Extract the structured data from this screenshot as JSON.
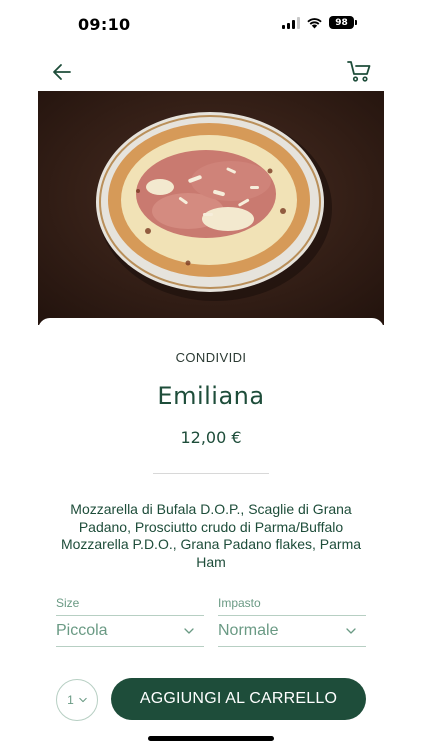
{
  "status_bar": {
    "time": "09:10",
    "battery": "98"
  },
  "nav": {
    "back_icon": "arrow-left-icon",
    "cart_icon": "cart-icon"
  },
  "hero": {
    "alt": "Emiliana pizza"
  },
  "product": {
    "share_label": "CONDIVIDI",
    "name": "Emiliana",
    "price": "12,00 €",
    "description": "Mozzarella di Bufala D.O.P., Scaglie di Grana Padano, Prosciutto crudo di Parma/Buffalo Mozzarella P.D.O., Grana Padano flakes, Parma Ham"
  },
  "options": {
    "size": {
      "label": "Size",
      "value": "Piccola"
    },
    "dough": {
      "label": "Impasto",
      "value": "Normale"
    }
  },
  "quantity": {
    "value": "1"
  },
  "cta": {
    "label": "AGGIUNGI AL CARRELLO"
  },
  "colors": {
    "brand": "#1e4d3a",
    "muted": "#6a9a84",
    "border": "#b7cfc3"
  }
}
